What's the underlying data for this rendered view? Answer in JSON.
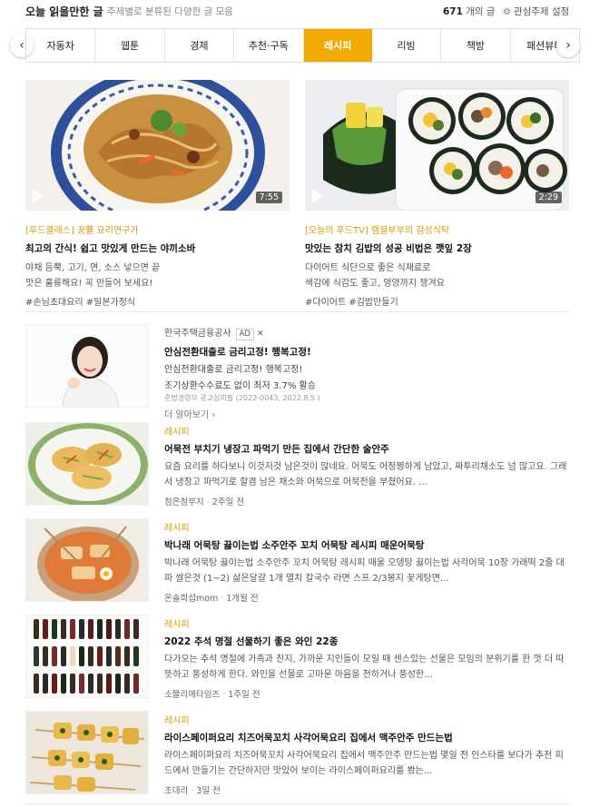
{
  "header": {
    "title": "오늘 읽을만한 글",
    "subtitle": "주제별로 분류된 다양한 글 모음",
    "count": "671",
    "count_suffix": "개의 글",
    "settings_label": "관심주제 설정"
  },
  "tabs": [
    "자동차",
    "웹툰",
    "경제",
    "추천·구독",
    "레시피",
    "리빙",
    "책방",
    "패션뷰티"
  ],
  "active_tab": "레시피",
  "featured": [
    {
      "duration": "7:55",
      "source": "[푸드클래스] 꿍쁄 요리연구가",
      "title": "최고의 간식! 쉽고 맛있게 만드는 야끼소바",
      "desc1": "야채 듬뿍, 고기, 면, 소스 넣으면 끝",
      "desc2": "맛은 훌륭해요! 꼭 만들어 보세요!",
      "tags": "#손님초대요리 #일본가정식"
    },
    {
      "duration": "2:29",
      "source": "[오늘의 푸드TV] 램블부부의 감성식탁",
      "title": "맛있는 참치 김밥의 성공 비법은 깻잎 2장",
      "desc1": "다이어트 식단으로 좋은 식재료로",
      "desc2": "색감에 식감도 좋고, 영양까지 챙겨요",
      "tags": "#다이어트 #김밥만들기"
    }
  ],
  "ad": {
    "advertiser": "한국주택금융공사",
    "badge": "AD",
    "close": "✕",
    "title": "안심전환대출로 금리고정! 행복고정!",
    "line1": "안심전환대출로 금리고정! 행복고정!",
    "line2": "조기상환수수료도 없이 최저 3.7% 활승",
    "small": "준법경영부 광고심의필 (2022-0043, 2022.8.5.)",
    "more": "더 알아보기 ›"
  },
  "items": [
    {
      "category": "레시피",
      "title": "어묵전 부치기 냉장고 파먹기 만든 집에서 간단한 술안주",
      "desc": "요즘 요리를 하다보니 이것저것 남은것이 많네요. 어묵도 어정쩡하게 남았고, 짜투리채소도 넘 많고요. 그래서 냉장고 파먹기로 할겸 남은 채소와 어묵으로 어묵전을 부쳤어요. ...",
      "author": "첨은첨부지",
      "time": "2주일 전"
    },
    {
      "category": "레시피",
      "title": "박나래 어묵탕 끓이는법 소주안주 꼬치 어묵탕 레시피 매운어묵탕",
      "desc": "박나래 어묵탕 끓이는법 소주안주 꼬치 어묵탕 레시피 매울 오뎅탕 끓이는법 사각어묵 10장 가래떡 2줄 대파 쌀은것 (1~2) 삶은달걀 1개 멸치 칼국수 라면 스프 2/3봉지 꽃게탕면...",
      "author": "온솔희섭mom",
      "time": "1개월 전"
    },
    {
      "category": "레시피",
      "title": "2022 추석 명절 선물하기 좋은 와인 22종",
      "desc": "다가오는 추석 명절에 가족과 친지, 가까운 지인들이 모일 때 센스있는 선물은 모임의 분위기를 한 껏 더 따뜻하고 풍성하게 한다. 와인을 선물로 고마운 마음을 전하거나 풍성한...",
      "author": "소믈리에타임즈",
      "time": "1주일 전"
    },
    {
      "category": "레시피",
      "title": "라이스페이퍼요리 치즈어묵꼬치 사각어묵요리 집에서 맥주안주 만드는법",
      "desc": "라이스페이퍼요리 치즈어묵꼬치 사각어묵요리 집에서 맥주안주 만드는법 몇일 전 인스타를 보다가 추천 피드에서 만들기는 간단하지만 맛있어 보이는 라이스페이퍼요리를 봤는...",
      "author": "초대리",
      "time": "3일 전"
    }
  ]
}
